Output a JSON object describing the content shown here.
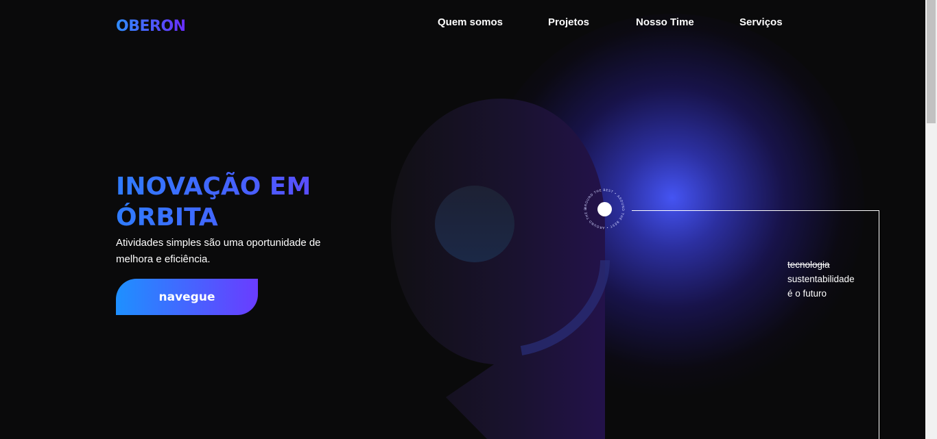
{
  "header": {
    "logo": "OBERON",
    "nav": [
      "Quem somos",
      "Projetos",
      "Nosso Time",
      "Serviços"
    ]
  },
  "hero": {
    "title_line1": "INOVAÇÃO EM",
    "title_line2": "ÓRBITA",
    "subtitle": "Atividades simples são uma oportunidade de melhora e eficiência.",
    "cta_label": "navegue"
  },
  "orbit": {
    "ring_text": "AROUND THE BEST • AROUND THE BEST • AROUND THE BEST •"
  },
  "tagline": {
    "struck": "tecnologia",
    "line2": "sustentabilidade",
    "line3": "é o futuro"
  },
  "colors": {
    "background": "#0a0a0b",
    "accent_start": "#1e90ff",
    "accent_end": "#6a3cff",
    "glow": "#4858ff"
  },
  "icons": [
    "planet-icon",
    "orbit-ring-icon"
  ]
}
